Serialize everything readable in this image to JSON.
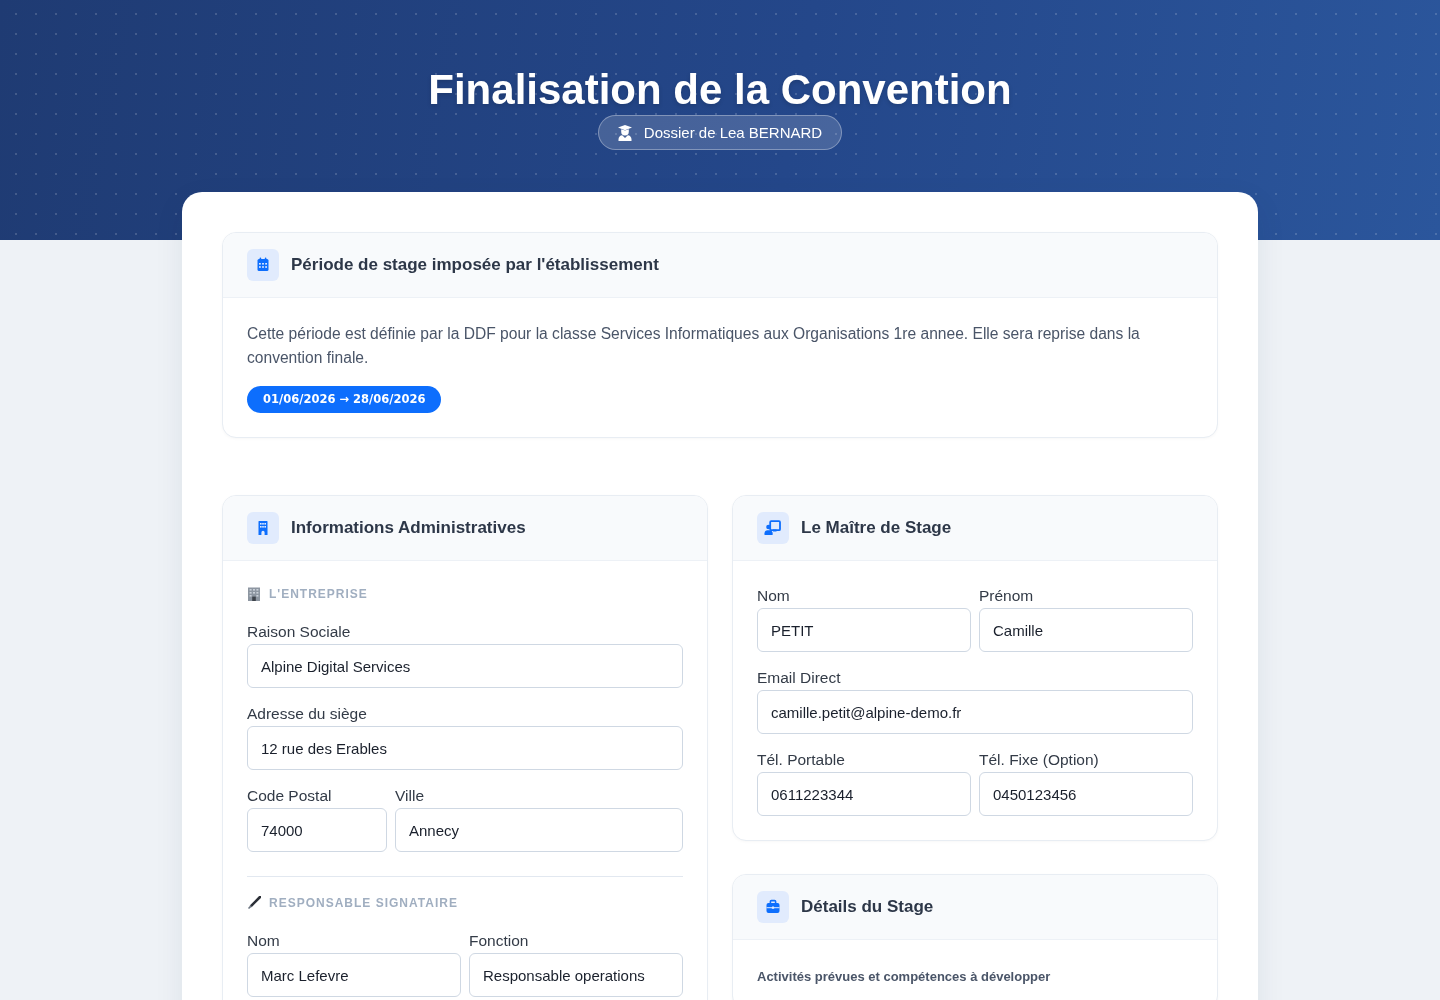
{
  "header": {
    "title": "Finalisation de la Convention",
    "dossier": "Dossier de Lea BERNARD"
  },
  "period": {
    "title": "Période de stage imposée par l'établissement",
    "description": "Cette période est définie par la DDF pour la classe Services Informatiques aux Organisations 1re annee. Elle sera reprise dans la convention finale.",
    "date_range": "01/06/2026 → 28/06/2026"
  },
  "administrative": {
    "title": "Informations Administratives",
    "groups": [
      {
        "heading": "L'ENTREPRISE",
        "rows": [
          [
            {
              "label": "Raison Sociale",
              "value": "Alpine Digital Services",
              "kind": "text"
            }
          ],
          [
            {
              "label": "Adresse du siège",
              "value": "12 rue des Erables",
              "kind": "text"
            }
          ],
          [
            {
              "label": "Code Postal",
              "value": "74000",
              "kind": "short"
            },
            {
              "label": "Ville",
              "value": "Annecy",
              "kind": "text"
            }
          ]
        ]
      },
      {
        "heading": "RESPONSABLE SIGNATAIRE",
        "rows": [
          [
            {
              "label": "Nom",
              "value": "Marc Lefevre",
              "kind": "text"
            },
            {
              "label": "Fonction",
              "value": "Responsable operations",
              "kind": "text"
            }
          ]
        ]
      }
    ]
  },
  "mentor": {
    "title": "Le Maître de Stage",
    "rows": [
      [
        {
          "label": "Nom",
          "value": "PETIT",
          "kind": "text"
        },
        {
          "label": "Prénom",
          "value": "Camille",
          "kind": "text"
        }
      ],
      [
        {
          "label": "Email Direct",
          "value": "camille.petit@alpine-demo.fr",
          "kind": "text"
        }
      ],
      [
        {
          "label": "Tél. Portable",
          "value": "0611223344",
          "kind": "text"
        },
        {
          "label": "Tél. Fixe (Option)",
          "value": "0450123456",
          "kind": "text"
        }
      ]
    ]
  },
  "details": {
    "title": "Détails du Stage",
    "activities_label": "Activités prévues et compétences à développer"
  }
}
